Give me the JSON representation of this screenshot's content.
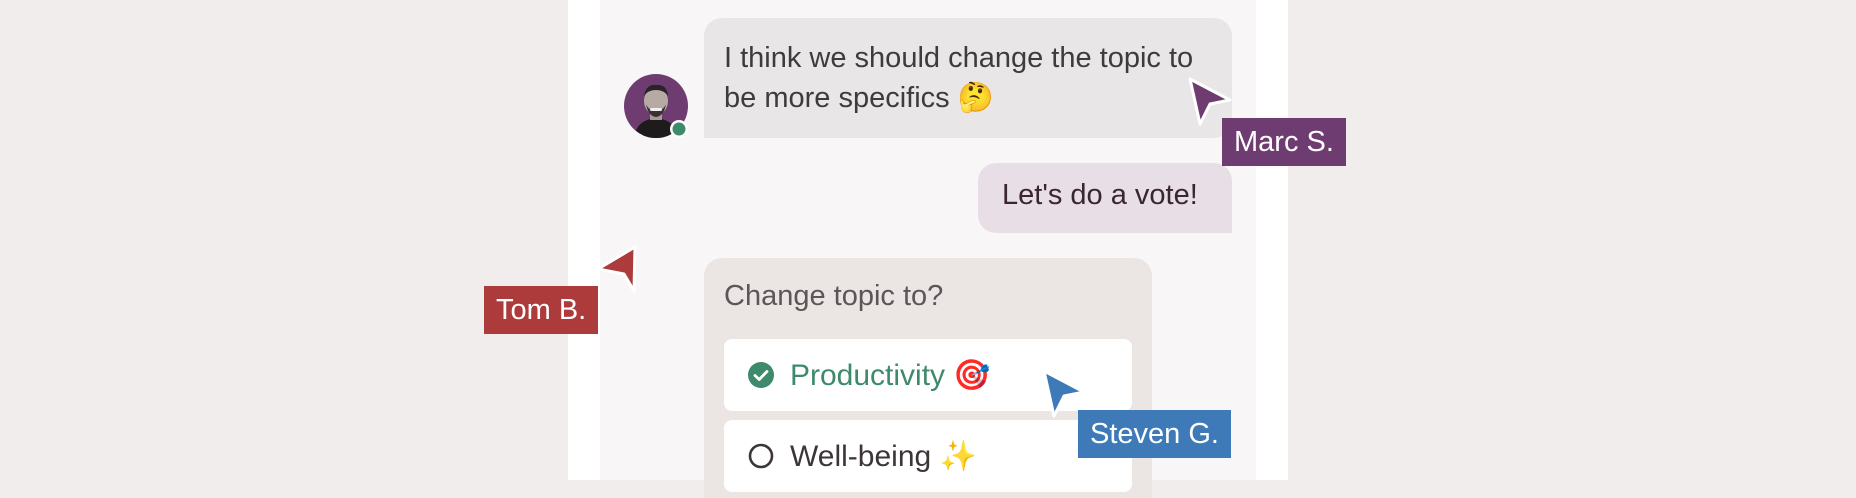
{
  "messages": [
    {
      "text": "I think we should change the topic to be more specifics 🤔"
    },
    {
      "text": "Let's do a vote!"
    }
  ],
  "poll": {
    "question": "Change topic to?",
    "options": [
      {
        "label": "Productivity 🎯",
        "selected": true
      },
      {
        "label": "Well-being ✨",
        "selected": false
      }
    ]
  },
  "cursors": [
    {
      "name": "Marc S.",
      "color": "#6e3c71"
    },
    {
      "name": "Tom B.",
      "color": "#ad3b3b"
    },
    {
      "name": "Steven G.",
      "color": "#3f7ab8"
    }
  ],
  "colors": {
    "background": "#f1edec",
    "chat_background": "#f8f6f7",
    "incoming_bubble": "#e8e6e7",
    "outgoing_bubble": "#e7dfe5",
    "poll_background": "#ebe5e4",
    "selected_option": "#3e8a6d",
    "online_status": "#3e8a6d"
  },
  "avatar": {
    "online": true
  }
}
